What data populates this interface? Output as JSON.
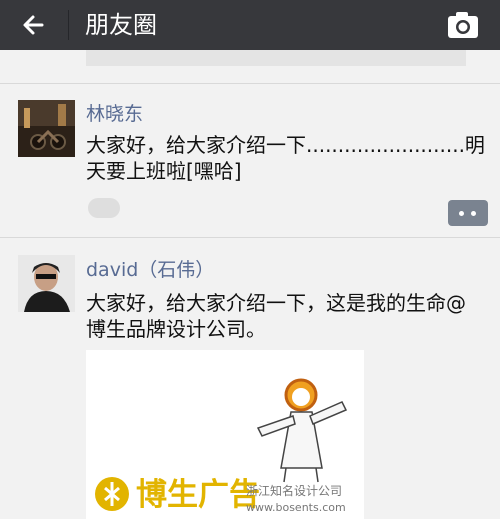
{
  "header": {
    "title": "朋友圈",
    "back_icon": "arrow-left-icon",
    "camera_icon": "camera-icon",
    "bg_color": "#37383c"
  },
  "posts": [
    {
      "name": "林晓东",
      "text_line1": "大家好，给大家介绍一下.........................明",
      "text_line2": "天要上班啦[嘿哈]",
      "comment_icon": "comment-icon"
    },
    {
      "name": "david（石伟）",
      "text_line1": "大家好，给大家介绍一下，这是我的生命@",
      "text_line2": "博生品牌设计公司。",
      "image": {
        "brand": "博生广告",
        "tagline": "浙江知名设计公司",
        "url": "www.bosents.com"
      }
    }
  ],
  "colors": {
    "name": "#586b93",
    "logo": "#e2b400"
  }
}
